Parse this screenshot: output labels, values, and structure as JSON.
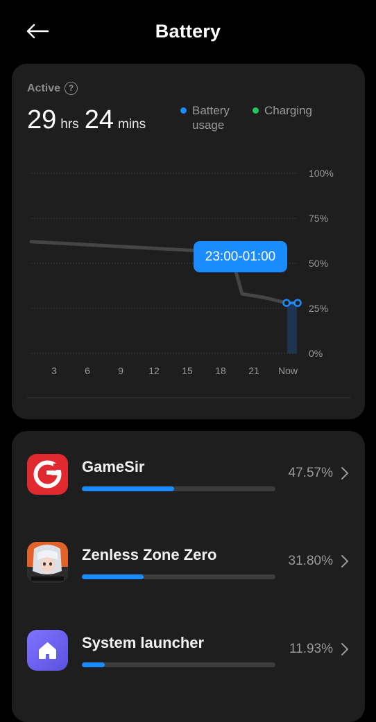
{
  "header": {
    "title": "Battery"
  },
  "summary": {
    "label": "Active",
    "hours": "29",
    "hours_unit": "hrs",
    "minutes": "24",
    "minutes_unit": "mins"
  },
  "legend": {
    "usage_line1": "Battery",
    "usage_line2": "usage",
    "charging": "Charging",
    "usage_color": "#1a8cff",
    "charging_color": "#22c55e"
  },
  "chart": {
    "tooltip": "23:00-01:00"
  },
  "chart_data": {
    "type": "line",
    "x_tick_labels": [
      "3",
      "6",
      "9",
      "12",
      "15",
      "18",
      "21",
      "Now"
    ],
    "y_tick_labels": [
      "100%",
      "75%",
      "50%",
      "25%",
      "0%"
    ],
    "ylim": [
      0,
      100
    ],
    "series": [
      {
        "x": [
          0,
          3,
          6,
          9,
          12,
          15,
          18,
          19,
          21,
          23,
          24
        ],
        "values": [
          62,
          61,
          60,
          59,
          58,
          57,
          55,
          33,
          31,
          28,
          28
        ]
      }
    ],
    "grid": true
  },
  "apps": [
    {
      "name": "GameSir",
      "percent_text": "47.57%",
      "usage_fraction": 0.4757
    },
    {
      "name": "Zenless Zone Zero",
      "percent_text": "31.80%",
      "usage_fraction": 0.318
    },
    {
      "name": "System launcher",
      "percent_text": "11.93%",
      "usage_fraction": 0.1193
    }
  ],
  "icons": {
    "back": "back-arrow-icon",
    "help": "question-circle-icon",
    "chevron": "chevron-right-icon"
  }
}
